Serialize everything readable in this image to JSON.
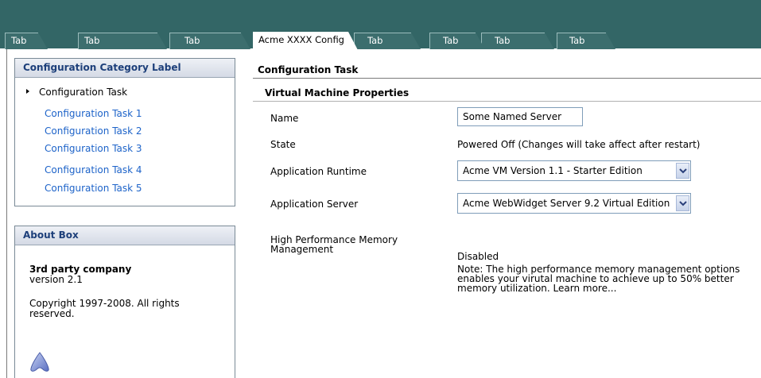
{
  "tabs": [
    {
      "label": "Tab",
      "active": false
    },
    {
      "label": "Tab",
      "active": false
    },
    {
      "label": "Tab",
      "active": false
    },
    {
      "label": "Acme XXXX Config",
      "active": true
    },
    {
      "label": "Tab",
      "active": false
    },
    {
      "label": "Tab",
      "active": false
    },
    {
      "label": "Tab",
      "active": false
    },
    {
      "label": "Tab",
      "active": false
    }
  ],
  "sidebar": {
    "category_title": "Configuration Category Label",
    "current_task": "Configuration Task",
    "tasks": [
      "Configuration Task 1",
      "Configuration Task 2",
      "Configuration Task 3",
      "Configuration Task 4",
      "Configuration Task 5"
    ],
    "about": {
      "title": "About Box",
      "company": "3rd party company",
      "version": "version 2.1",
      "copyright": "Copyright 1997-2008.  All rights reserved."
    }
  },
  "main": {
    "title": "Configuration Task",
    "section_title": "Virtual Machine Properties",
    "name_label": "Name",
    "name_value": "Some Named Server",
    "state_label": "State",
    "state_value": "Powered Off  (Changes will take affect after restart)",
    "runtime_label": "Application Runtime",
    "runtime_value": "Acme  VM Version 1.1 - Starter Edition",
    "server_label": "Application Server",
    "server_value": "Acme WebWidget  Server 9.2 Virtual Edition",
    "memory_label": "High Performance Memory Management",
    "memory_value": "Disabled",
    "memory_note": "Note: The high performance memory management options enables your virutal machine to achieve up to 50% better memory utilization. Learn more..."
  },
  "colors": {
    "header": "#336666",
    "link": "#1d63c9",
    "panel_title": "#1d3f7a"
  }
}
